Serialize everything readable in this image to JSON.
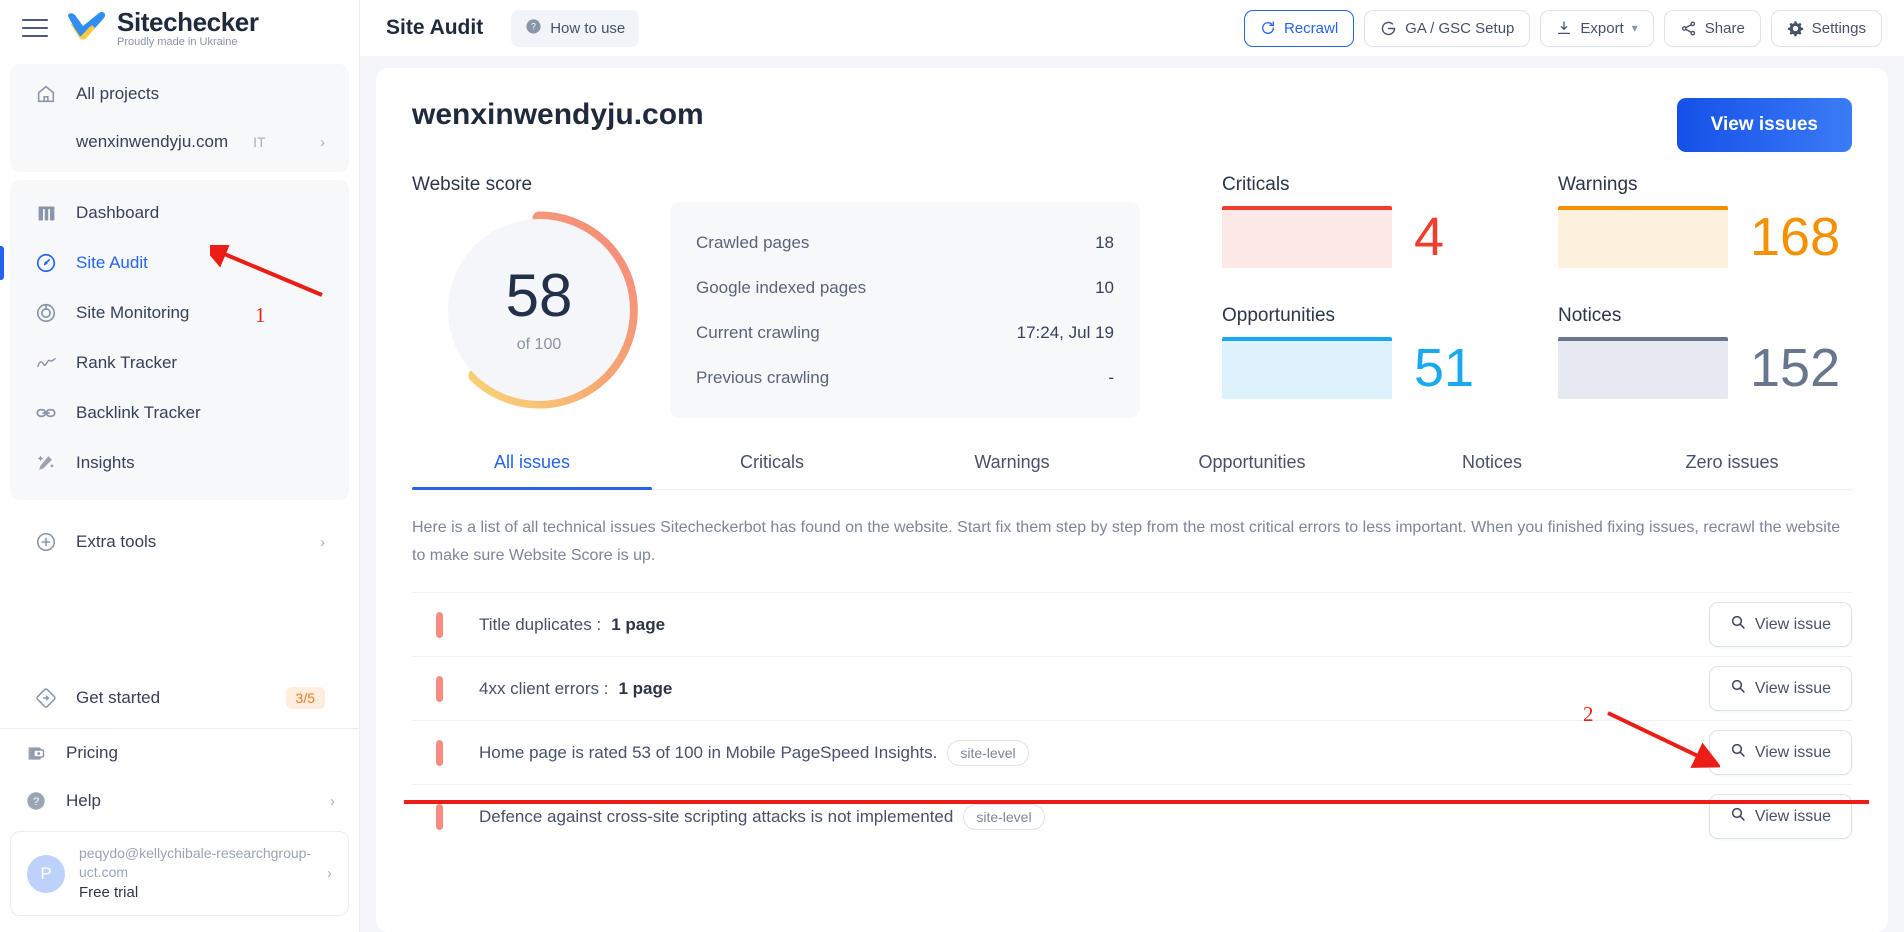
{
  "brand": {
    "name": "Sitechecker",
    "tagline": "Proudly made in Ukraine"
  },
  "sidebar": {
    "all_projects": {
      "label": "All projects",
      "icon": "home-icon"
    },
    "project": {
      "name": "wenxinwendyju.com",
      "country": "IT",
      "chevron": "›"
    },
    "nav": [
      {
        "label": "Dashboard",
        "icon": "dashboard-icon",
        "active": false
      },
      {
        "label": "Site Audit",
        "icon": "site-audit-icon",
        "active": true
      },
      {
        "label": "Site Monitoring",
        "icon": "site-monitoring-icon",
        "active": false
      },
      {
        "label": "Rank Tracker",
        "icon": "rank-tracker-icon",
        "active": false
      },
      {
        "label": "Backlink Tracker",
        "icon": "backlink-tracker-icon",
        "active": false
      },
      {
        "label": "Insights",
        "icon": "insights-icon",
        "active": false
      }
    ],
    "extra_tools": {
      "label": "Extra tools",
      "icon": "plus-circle-icon",
      "chevron": "›"
    },
    "get_started": {
      "label": "Get started",
      "icon": "diamond-arrow-icon",
      "badge": "3/5"
    },
    "pricing": {
      "label": "Pricing",
      "icon": "wallet-icon"
    },
    "help": {
      "label": "Help",
      "icon": "help-icon",
      "chevron": "›"
    },
    "user": {
      "initial": "P",
      "email": "peqydo@kellychibale-researchgroup-uct.com",
      "plan": "Free trial",
      "chevron": "›"
    }
  },
  "topbar": {
    "title": "Site Audit",
    "how_to_use": "How to use",
    "buttons": [
      {
        "label": "Recrawl",
        "icon": "recrawl-icon",
        "primary": true
      },
      {
        "label": "GA / GSC Setup",
        "icon": "google-icon",
        "primary": false
      },
      {
        "label": "Export",
        "icon": "download-icon",
        "caret": "▾",
        "primary": false
      },
      {
        "label": "Share",
        "icon": "share-icon",
        "primary": false
      },
      {
        "label": "Settings",
        "icon": "gear-icon",
        "primary": false
      }
    ]
  },
  "page": {
    "site_title": "wenxinwendyju.com",
    "view_issues_label": "View issues",
    "website_score_label": "Website score",
    "score": {
      "value": "58",
      "of": "of 100"
    },
    "stats": [
      {
        "label": "Crawled pages",
        "value": "18"
      },
      {
        "label": "Google indexed pages",
        "value": "10"
      },
      {
        "label": "Current crawling",
        "value": "17:24, Jul 19"
      },
      {
        "label": "Previous crawling",
        "value": "-"
      }
    ],
    "metrics": [
      {
        "label": "Criticals",
        "value": "4",
        "color": "#ef3d2e",
        "fill": "#fce8e6"
      },
      {
        "label": "Warnings",
        "value": "168",
        "color": "#f59000",
        "fill": "#fdf0dd"
      },
      {
        "label": "Opportunities",
        "value": "51",
        "color": "#18a9ef",
        "fill": "#ddf2fd"
      },
      {
        "label": "Notices",
        "value": "152",
        "color": "#68768e",
        "fill": "#e6e9ef"
      }
    ],
    "tabs": [
      {
        "label": "All issues",
        "active": true
      },
      {
        "label": "Criticals",
        "active": false
      },
      {
        "label": "Warnings",
        "active": false
      },
      {
        "label": "Opportunities",
        "active": false
      },
      {
        "label": "Notices",
        "active": false
      },
      {
        "label": "Zero issues",
        "active": false
      }
    ],
    "description": "Here is a list of all technical issues Sitecheckerbot has found on the website. Start fix them step by step from the most critical errors to less important. When you finished fixing issues, recrawl the website to make sure Website Score is up.",
    "view_issue_label": "View issue",
    "issues": [
      {
        "text": "Title duplicates : ",
        "count": "1 page",
        "badge": ""
      },
      {
        "text": "4xx client errors : ",
        "count": "1 page",
        "badge": ""
      },
      {
        "text": "Home page is rated 53 of 100 in Mobile PageSpeed Insights.",
        "count": "",
        "badge": "site-level"
      },
      {
        "text": "Defence against cross-site scripting attacks is not implemented",
        "count": "",
        "badge": "site-level"
      }
    ]
  },
  "annotations": [
    {
      "number": "1",
      "target": "sidebar-item-site-audit"
    },
    {
      "number": "2",
      "target": "view-issue-button-row-2"
    }
  ]
}
